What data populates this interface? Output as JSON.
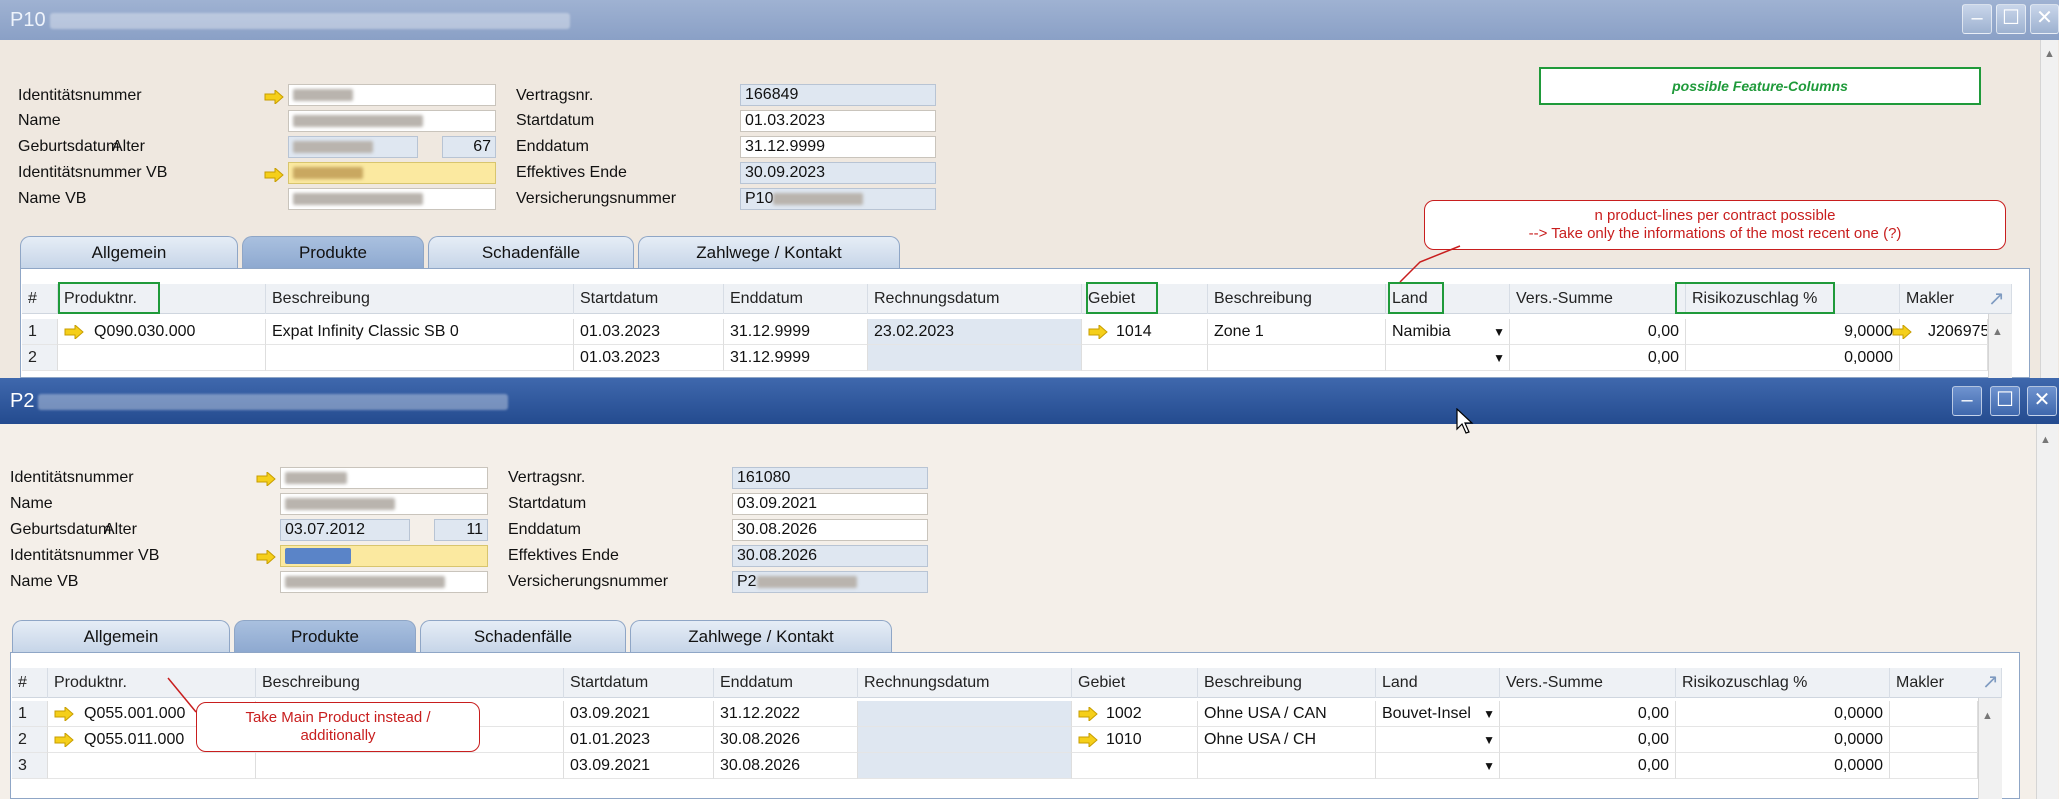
{
  "colors": {
    "annotation_green": "#1f9a3a",
    "annotation_red": "#c81e1e",
    "arrow_yellow": "#e0b400"
  },
  "win1": {
    "title_prefix": "P10",
    "labels": [
      "Identitätsnummer",
      "Name",
      "Geburtsdatum",
      "Alter",
      "Identitätsnummer VB",
      "Name VB"
    ],
    "right_labels": [
      "Vertragsnr.",
      "Startdatum",
      "Enddatum",
      "Effektives Ende",
      "Versicherungsnummer"
    ],
    "right_values": [
      "166849",
      "01.03.2023",
      "31.12.9999",
      "30.09.2023",
      "P10"
    ],
    "alter_value": "67",
    "tabs": [
      "Allgemein",
      "Produkte",
      "Schadenfälle",
      "Zahlwege / Kontakt"
    ],
    "columns": [
      "#",
      "Produktnr.",
      "Beschreibung",
      "Startdatum",
      "Enddatum",
      "Rechnungsdatum",
      "Gebiet",
      "Beschreibung",
      "Land",
      "Vers.-Summe",
      "Risikozuschlag %",
      "Makler"
    ],
    "rows": [
      [
        "1",
        "Q090.030.000",
        "Expat Infinity Classic SB 0",
        "01.03.2023",
        "31.12.9999",
        "23.02.2023",
        "1014",
        "Zone 1",
        "Namibia",
        "0,00",
        "9,0000",
        "J206975"
      ],
      [
        "2",
        "",
        "",
        "01.03.2023",
        "31.12.9999",
        "",
        "",
        "",
        "",
        "0,00",
        "0,0000",
        ""
      ]
    ],
    "feature_box": "possible Feature-Columns",
    "callout": [
      "n product-lines per contract possible",
      "--> Take only the informations of the most recent one (?)"
    ]
  },
  "win2": {
    "title_prefix": "P2",
    "labels": [
      "Identitätsnummer",
      "Name",
      "Geburtsdatum",
      "Alter",
      "Identitätsnummer VB",
      "Name VB"
    ],
    "geburtsdatum": "03.07.2012",
    "alter_value": "11",
    "right_labels": [
      "Vertragsnr.",
      "Startdatum",
      "Enddatum",
      "Effektives Ende",
      "Versicherungsnummer"
    ],
    "right_values": [
      "161080",
      "03.09.2021",
      "30.08.2026",
      "30.08.2026",
      "P2"
    ],
    "tabs": [
      "Allgemein",
      "Produkte",
      "Schadenfälle",
      "Zahlwege / Kontakt"
    ],
    "columns": [
      "#",
      "Produktnr.",
      "Beschreibung",
      "Startdatum",
      "Enddatum",
      "Rechnungsdatum",
      "Gebiet",
      "Beschreibung",
      "Land",
      "Vers.-Summe",
      "Risikozuschlag %",
      "Makler"
    ],
    "rows": [
      [
        "1",
        "Q055.001.000",
        "",
        "03.09.2021",
        "31.12.2022",
        "",
        "1002",
        "Ohne USA / CAN",
        "Bouvet-Insel",
        "0,00",
        "0,0000",
        ""
      ],
      [
        "2",
        "Q055.011.000",
        "",
        "01.01.2023",
        "30.08.2026",
        "",
        "1010",
        "Ohne USA / CH",
        "",
        "0,00",
        "0,0000",
        ""
      ],
      [
        "3",
        "",
        "",
        "03.09.2021",
        "30.08.2026",
        "",
        "",
        "",
        "",
        "0,00",
        "0,0000",
        ""
      ]
    ],
    "callout": [
      "Take Main Product instead /",
      "additionally"
    ]
  },
  "icons": [
    "minimize-icon",
    "maximize-icon",
    "close-icon",
    "link-arrow-icon",
    "dropdown-arrow-icon",
    "expand-icon",
    "mouse-cursor-icon"
  ]
}
